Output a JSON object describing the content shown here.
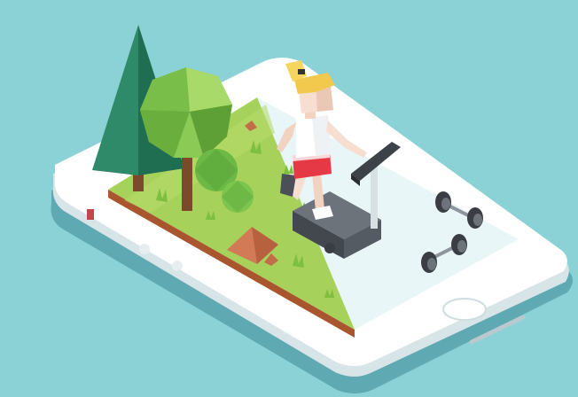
{
  "scene": {
    "kind": "isometric illustration",
    "colors": {
      "background": "#8AD2D6",
      "phone_body": "#FFFFFF",
      "phone_shadow": "#5FA9B2",
      "grass": "#A6D15A",
      "gym_floor": "#E9F6F8",
      "tree_dark": "#2E8A68",
      "tree_light": "#8BCB55",
      "hair": "#F2C94C",
      "shorts": "#E53945",
      "treadmill": "#555B63"
    },
    "icons": [
      "phone",
      "pine-tree",
      "round-tree",
      "bush",
      "rock",
      "runner-woman",
      "treadmill",
      "dumbbell",
      "home-button"
    ]
  }
}
